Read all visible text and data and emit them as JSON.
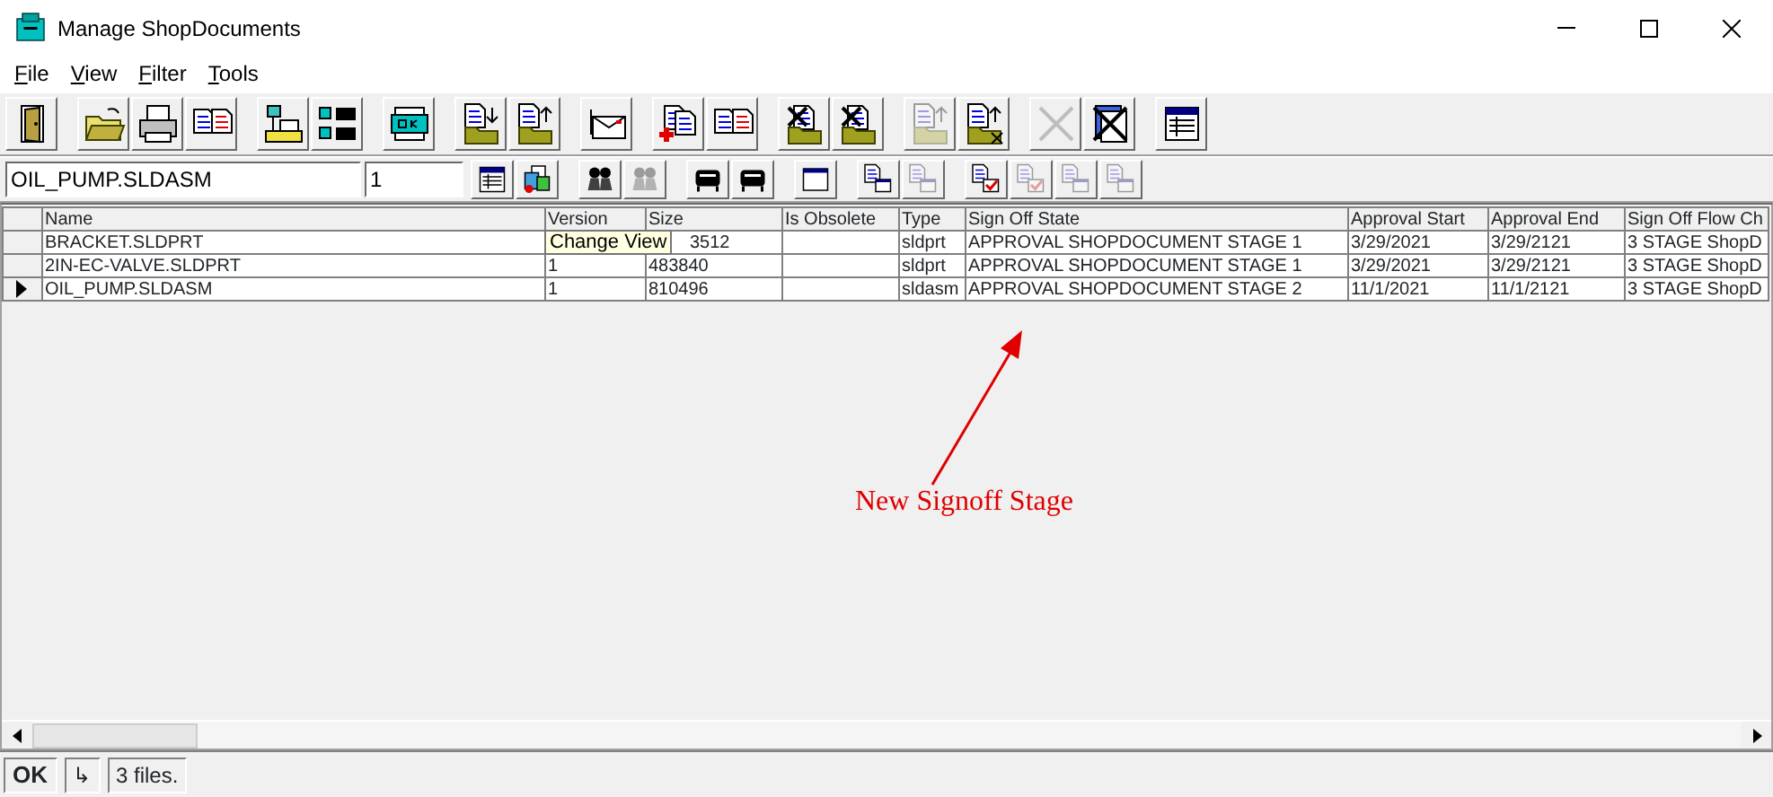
{
  "window": {
    "title": "Manage ShopDocuments"
  },
  "menu": [
    {
      "label": "File"
    },
    {
      "label": "View"
    },
    {
      "label": "Filter"
    },
    {
      "label": "Tools"
    }
  ],
  "toolbar": [
    [
      {
        "kind": "door",
        "disabled": false
      }
    ],
    [
      {
        "kind": "folder",
        "disabled": false
      },
      {
        "kind": "printer",
        "disabled": false
      },
      {
        "kind": "documents",
        "disabled": false
      }
    ],
    [
      {
        "kind": "flowchart",
        "disabled": false
      },
      {
        "kind": "okgrid",
        "disabled": false
      }
    ],
    [
      {
        "kind": "okdoc",
        "disabled": false
      }
    ],
    [
      {
        "kind": "docdown",
        "disabled": false
      },
      {
        "kind": "docup",
        "disabled": false
      }
    ],
    [
      {
        "kind": "envelope",
        "disabled": false
      }
    ],
    [
      {
        "kind": "docadd",
        "disabled": false
      },
      {
        "kind": "documents",
        "disabled": false
      }
    ],
    [
      {
        "kind": "docremove",
        "disabled": false
      },
      {
        "kind": "docremove",
        "disabled": false
      }
    ],
    [
      {
        "kind": "docup",
        "disabled": true
      },
      {
        "kind": "docupx",
        "disabled": false
      }
    ],
    [
      {
        "kind": "cross",
        "disabled": true
      },
      {
        "kind": "crossdocs",
        "disabled": false
      }
    ],
    [
      {
        "kind": "table",
        "disabled": false
      }
    ]
  ],
  "search": {
    "name": "OIL_PUMP.SLDASM",
    "version": "1"
  },
  "toolbar2": [
    [
      {
        "kind": "table",
        "disabled": false
      },
      {
        "kind": "colordocs",
        "disabled": false
      }
    ],
    [
      {
        "kind": "people",
        "disabled": false
      },
      {
        "kind": "people",
        "disabled": true
      }
    ],
    [
      {
        "kind": "machine",
        "disabled": false
      },
      {
        "kind": "machine",
        "disabled": false
      }
    ],
    [
      {
        "kind": "window",
        "disabled": false
      }
    ],
    [
      {
        "kind": "docwindow",
        "disabled": false
      },
      {
        "kind": "docwindow",
        "disabled": true
      }
    ],
    [
      {
        "kind": "doccheck",
        "disabled": false
      },
      {
        "kind": "doccheck",
        "disabled": true
      },
      {
        "kind": "docwindow",
        "disabled": true
      },
      {
        "kind": "docwindow",
        "disabled": true
      }
    ]
  ],
  "table": {
    "columns": [
      "Name",
      "Version",
      "Size",
      "Is Obsolete",
      "Type",
      "Sign Off State",
      "Approval Start",
      "Approval End",
      "Sign Off Flow Ch"
    ],
    "rows": [
      {
        "selected": false,
        "cells": [
          "BRACKET.SLDPRT",
          "",
          "3512",
          "",
          "sldprt",
          "APPROVAL SHOPDOCUMENT STAGE 1",
          "3/29/2021",
          "3/29/2121",
          "3 STAGE ShopD"
        ]
      },
      {
        "selected": false,
        "cells": [
          "2IN-EC-VALVE.SLDPRT",
          "1",
          "483840",
          "",
          "sldprt",
          "APPROVAL SHOPDOCUMENT STAGE 1",
          "3/29/2021",
          "3/29/2121",
          "3 STAGE ShopD"
        ]
      },
      {
        "selected": true,
        "cells": [
          "OIL_PUMP.SLDASM",
          "1",
          "810496",
          "",
          "sldasm",
          "APPROVAL SHOPDOCUMENT STAGE 2",
          "11/1/2021",
          "11/1/2121",
          "3 STAGE ShopD"
        ]
      }
    ]
  },
  "tooltip": "Change View",
  "annotation": "New Signoff Stage",
  "status_bar": {
    "ok": "OK",
    "arrow": "↳",
    "message": "3 files."
  }
}
